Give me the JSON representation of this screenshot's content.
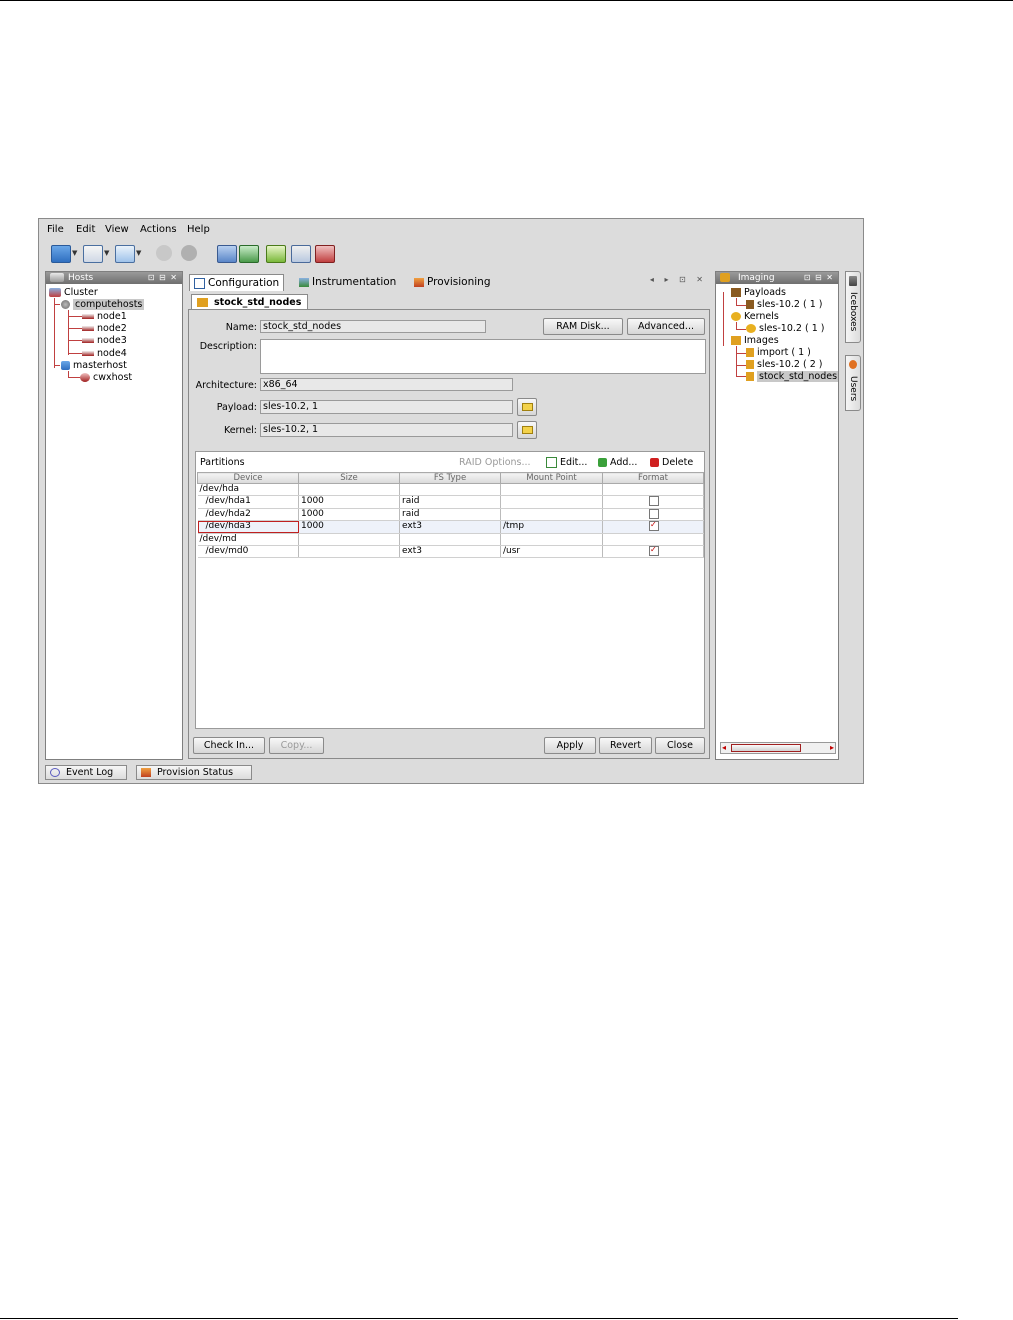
{
  "menu": {
    "items": [
      {
        "label": "File"
      },
      {
        "label": "Edit"
      },
      {
        "label": "View"
      },
      {
        "label": "Actions"
      },
      {
        "label": "Help"
      }
    ]
  },
  "toolbar": {
    "icons": [
      "new-icon",
      "layout-icon",
      "favorites-icon",
      "power-on-icon",
      "power-off-icon",
      "database-icon",
      "sync-icon",
      "upload-icon",
      "search-icon",
      "checkmark-icon"
    ]
  },
  "hosts_panel": {
    "title": "Hosts",
    "controls": "⊡ ⊟ ✕",
    "tree": {
      "root": "Cluster",
      "group1": "computehosts",
      "nodes": [
        "node1",
        "node2",
        "node3",
        "node4"
      ],
      "group2": "masterhost",
      "master_child": "cwxhost"
    }
  },
  "center_tabs": {
    "configuration": "Configuration",
    "instrumentation": "Instrumentation",
    "provisioning": "Provisioning",
    "controls": "◂ ▸ ⊡ ✕"
  },
  "doc_tab": "stock_std_nodes",
  "form": {
    "name_label": "Name:",
    "name_value": "stock_std_nodes",
    "ram_disk_button": "RAM Disk...",
    "advanced_button": "Advanced...",
    "description_label": "Description:",
    "description_value": "",
    "architecture_label": "Architecture:",
    "architecture_value": "x86_64",
    "payload_label": "Payload:",
    "payload_value": "sles-10.2, 1",
    "kernel_label": "Kernel:",
    "kernel_value": "sles-10.2, 1"
  },
  "partitions": {
    "title": "Partitions",
    "raid_options": "RAID Options...",
    "edit": "Edit...",
    "add": "Add...",
    "delete": "Delete",
    "columns": [
      "Device",
      "Size",
      "FS Type",
      "Mount Point",
      "Format"
    ],
    "rows": [
      {
        "device": "/dev/hda",
        "size": "",
        "fs": "",
        "mount": "",
        "format": null
      },
      {
        "device": "  /dev/hda1",
        "size": "1000",
        "fs": "raid",
        "mount": "",
        "format": false
      },
      {
        "device": "  /dev/hda2",
        "size": "1000",
        "fs": "raid",
        "mount": "",
        "format": false
      },
      {
        "device": "  /dev/hda3",
        "size": "1000",
        "fs": "ext3",
        "mount": "/tmp",
        "format": true
      },
      {
        "device": "/dev/md",
        "size": "",
        "fs": "",
        "mount": "",
        "format": null
      },
      {
        "device": "  /dev/md0",
        "size": "",
        "fs": "ext3",
        "mount": "/usr",
        "format": true
      }
    ]
  },
  "footer_buttons": {
    "check_in": "Check In...",
    "copy": "Copy...",
    "apply": "Apply",
    "revert": "Revert",
    "close": "Close"
  },
  "imaging_panel": {
    "title": "Imaging",
    "controls": "⊡ ⊟ ✕",
    "payloads": "Payloads",
    "payload_item": "sles-10.2 ( 1 )",
    "kernels": "Kernels",
    "kernel_item": "sles-10.2 ( 1 )",
    "images": "Images",
    "image_items": [
      "import ( 1 )",
      "sles-10.2 ( 2 )",
      "stock_std_nodes"
    ]
  },
  "side_tabs": {
    "iceboxes": "Iceboxes",
    "users": "Users"
  },
  "bottom_tabs": {
    "event_log": "Event Log",
    "provision_status": "Provision Status"
  },
  "colors": {
    "panel_title": "#7a7a7a",
    "selection": "#c8c8c8",
    "tree_lines": "#c04040",
    "check_mark": "#c00000"
  }
}
